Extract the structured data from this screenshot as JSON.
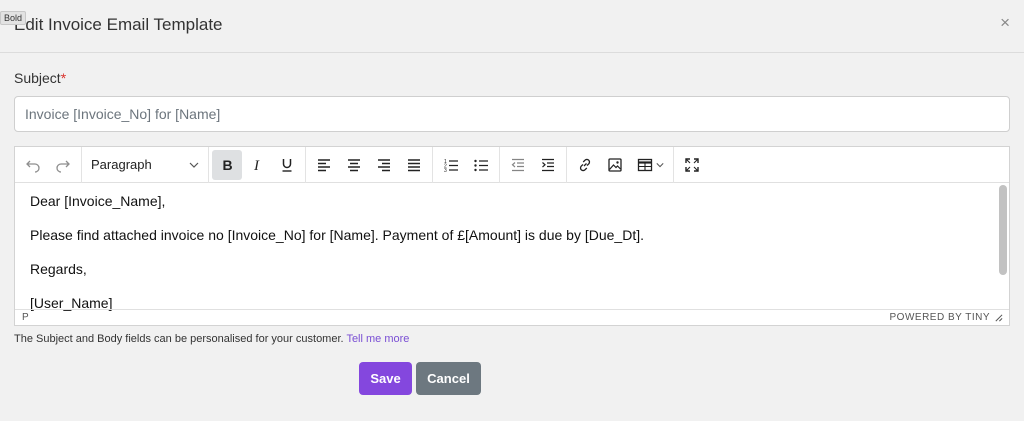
{
  "tooltip": "Bold",
  "modal": {
    "title": "Edit Invoice Email Template",
    "close_glyph": "×"
  },
  "subject": {
    "label": "Subject",
    "required_mark": "*",
    "value": "Invoice [Invoice_No] for [Name]"
  },
  "editor": {
    "block_format": "Paragraph",
    "toolbar_icons": [
      "undo-icon",
      "redo-icon",
      "bold-icon",
      "italic-icon",
      "underline-icon",
      "align-left-icon",
      "align-center-icon",
      "align-right-icon",
      "align-justify-icon",
      "numbered-list-icon",
      "bullet-list-icon",
      "outdent-icon",
      "indent-icon",
      "link-icon",
      "image-icon",
      "table-icon",
      "fullscreen-icon"
    ],
    "content": [
      "Dear [Invoice_Name],",
      "Please find attached invoice no [Invoice_No] for [Name].  Payment of £[Amount] is due by [Due_Dt].",
      "Regards,",
      "[User_Name]"
    ],
    "status_path": "P",
    "status_brand": "POWERED BY TINY"
  },
  "help": {
    "text": "The Subject and Body fields can be personalised for your customer.",
    "link": "Tell me more"
  },
  "buttons": {
    "save": "Save",
    "cancel": "Cancel"
  },
  "colors": {
    "accent": "#8447de",
    "secondary": "#6d7880",
    "required": "#d9312b",
    "link": "#7a4fd4"
  }
}
